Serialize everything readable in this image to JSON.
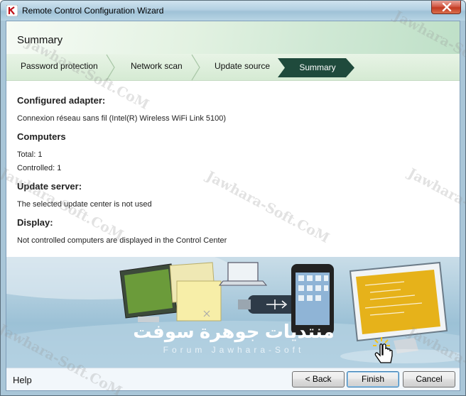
{
  "window": {
    "title": "Remote Control Configuration Wizard"
  },
  "header": {
    "page_title": "Summary"
  },
  "steps": [
    {
      "label": "Password protection",
      "active": false
    },
    {
      "label": "Network scan",
      "active": false
    },
    {
      "label": "Update source",
      "active": false
    },
    {
      "label": "Summary",
      "active": true
    }
  ],
  "summary": {
    "adapter_heading": "Configured adapter:",
    "adapter_value": "Connexion réseau sans fil (Intel(R) Wireless WiFi Link 5100)",
    "computers_heading": "Computers",
    "total": "Total: 1",
    "controlled": "Controlled: 1",
    "update_heading": "Update server:",
    "update_value": "The selected update center is not used",
    "display_heading": "Display:",
    "display_value": "Not controlled computers are displayed in the Control Center"
  },
  "banner": {
    "arabic_text": "منتديات جوهرة سوفت",
    "latin_text": "Forum Jawhara-Soft"
  },
  "watermark": {
    "text": "Jawhara-Soft.CoM"
  },
  "footer": {
    "help_label": "Help",
    "back_label": "< Back",
    "finish_label": "Finish",
    "cancel_label": "Cancel"
  },
  "colors": {
    "active_step": "#1f4a3c",
    "accent_green": "#d5ead3",
    "finish_border": "#3c7fb1"
  }
}
